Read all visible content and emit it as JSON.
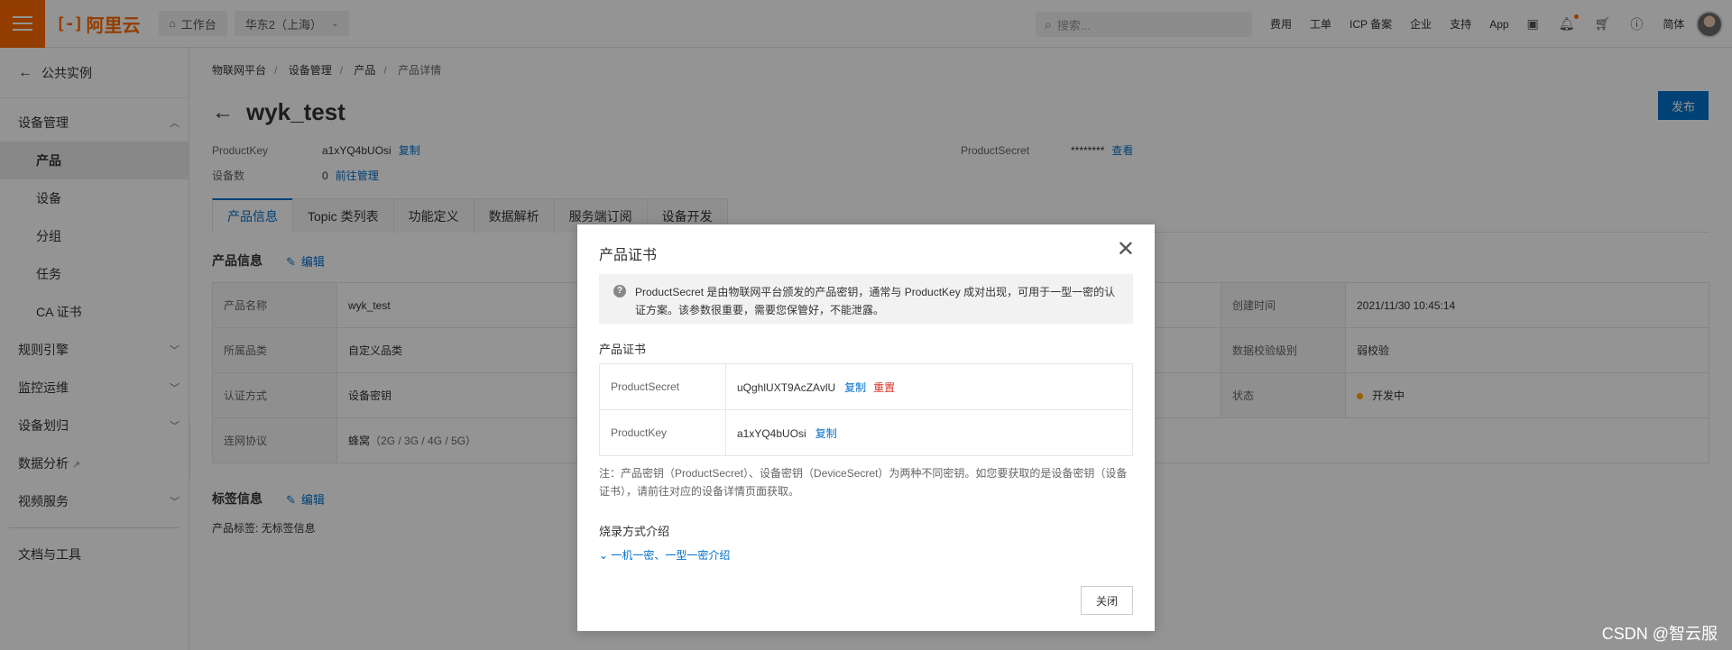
{
  "topbar": {
    "logo_text": "阿里云",
    "workbench": "工作台",
    "region": "华东2（上海）",
    "search_placeholder": "搜索...",
    "links": [
      "费用",
      "工单",
      "ICP 备案",
      "企业",
      "支持",
      "App"
    ],
    "lang": "简体"
  },
  "sidebar": {
    "back": "公共实例",
    "group_device": "设备管理",
    "items": [
      "产品",
      "设备",
      "分组",
      "任务",
      "CA 证书"
    ],
    "groups": [
      "规则引擎",
      "监控运维",
      "设备划归",
      "数据分析",
      "视频服务"
    ],
    "docs": "文档与工具"
  },
  "main": {
    "breadcrumbs": [
      "物联网平台",
      "设备管理",
      "产品",
      "产品详情"
    ],
    "title": "wyk_test",
    "publish": "发布",
    "product_key_label": "ProductKey",
    "product_key": "a1xYQ4bUOsi",
    "copy": "复制",
    "device_count_label": "设备数",
    "device_count": "0",
    "manage": "前往管理",
    "product_secret_label": "ProductSecret",
    "product_secret_masked": "********",
    "view": "查看",
    "tabs": [
      "产品信息",
      "Topic 类列表",
      "功能定义",
      "数据解析",
      "服务端订阅",
      "设备开发"
    ],
    "info_title": "产品信息",
    "edit": "编辑",
    "info_rows": [
      {
        "k": "产品名称",
        "v": "wyk_test",
        "k2": "创建时间",
        "v2": "2021/11/30 10:45:14"
      },
      {
        "k": "所属品类",
        "v": "自定义品类",
        "k2": "数据校验级别",
        "v2": "弱校验"
      },
      {
        "k": "认证方式",
        "v": "设备密钥",
        "k2": "状态",
        "v2": "开发中"
      },
      {
        "k": "连网协议",
        "v": "蜂窝",
        "v_extra": "（2G / 3G / 4G / 5G）"
      }
    ],
    "tag_title": "标签信息",
    "tag_line": "产品标签:   无标签信息"
  },
  "dialog": {
    "title": "产品证书",
    "notice": "ProductSecret 是由物联网平台颁发的产品密钥，通常与 ProductKey 成对出现，可用于一型一密的认证方案。该参数很重要，需要您保管好，不能泄露。",
    "cert_title": "产品证书",
    "rows": [
      {
        "k": "ProductSecret",
        "v": "uQghlUXT9AcZAvlU",
        "copy": "复制",
        "reset": "重置"
      },
      {
        "k": "ProductKey",
        "v": "a1xYQ4bUOsi",
        "copy": "复制"
      }
    ],
    "note": "注：产品密钥（ProductSecret）、设备密钥（DeviceSecret）为两种不同密钥。如您要获取的是设备密钥（设备证书），请前往对应的设备详情页面获取。",
    "burn_title": "烧录方式介绍",
    "expand": "一机一密、一型一密介绍",
    "close": "关闭"
  },
  "watermark": "CSDN @智云服"
}
